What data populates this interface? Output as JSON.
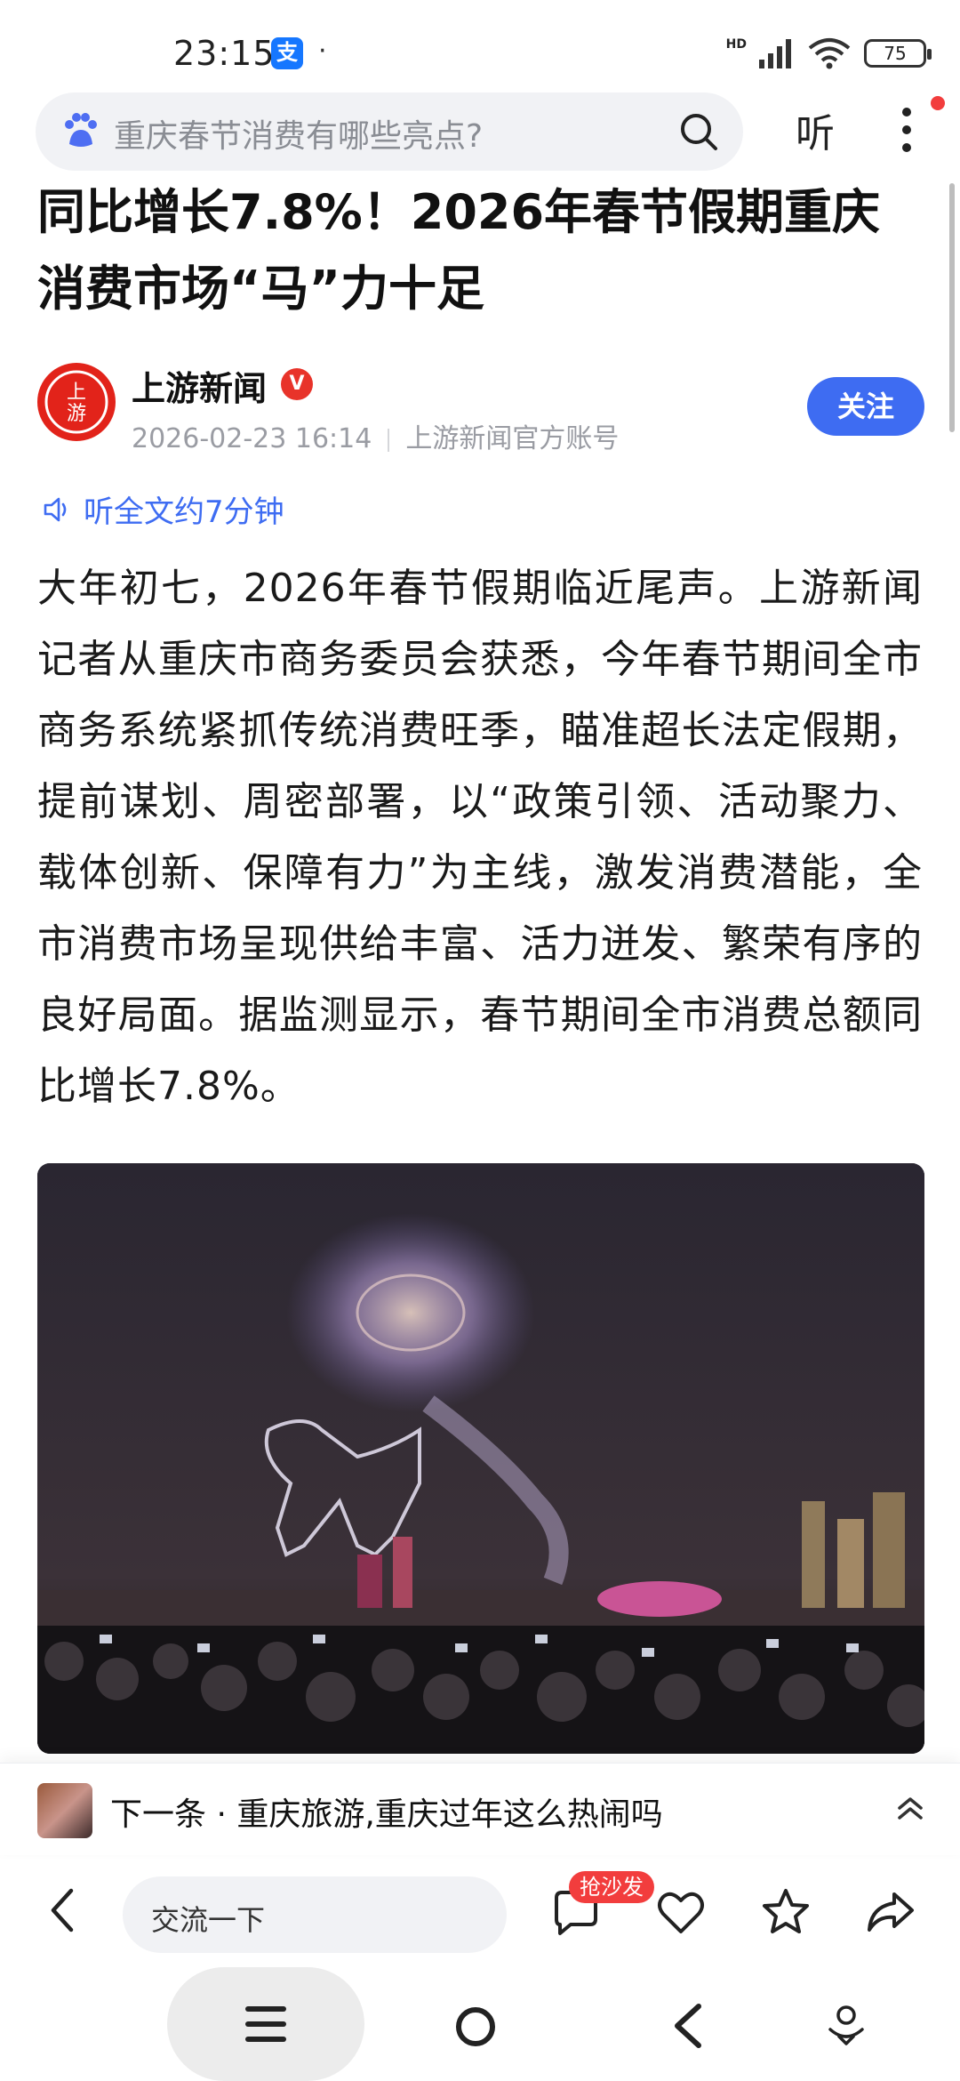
{
  "status_bar": {
    "time": "23:15",
    "app_badge": "支",
    "dot": "·",
    "network": "HD",
    "battery": "75"
  },
  "search": {
    "query": "重庆春节消费有哪些亮点?",
    "listen_label": "听"
  },
  "article": {
    "title": "同比增长7.8%！2026年春节假期重庆消费市场“马”力十足",
    "author_name": "上游新闻",
    "verified_mark": "V",
    "logo_text": "上游",
    "publish_time": "2026-02-23 16:14",
    "account_type": "上游新闻官方账号",
    "follow_label": "关注",
    "listen_full_label": "听全文约7分钟",
    "body": "大年初七，2026年春节假期临近尾声。上游新闻记者从重庆市商务委员会获悉，今年春节期间全市商务系统紧抓传统消费旺季，瞄准超长法定假期，提前谋划、周密部署，以“政策引领、活动聚力、载体创新、保障有力”为主线，激发消费潜能，全市消费市场呈现供给丰富、活力迸发、繁荣有序的良好局面。据监测显示，春节期间全市消费总额同比增长7.8%。"
  },
  "next": {
    "label": "下一条 · 重庆旅游,重庆过年这么热闹吗"
  },
  "actions": {
    "comment_placeholder": "交流一下",
    "sofa_badge": "抢沙发"
  },
  "colors": {
    "accent_blue": "#3e6cf2",
    "brand_red": "#e2231a",
    "badge_red": "#f23d3d"
  }
}
